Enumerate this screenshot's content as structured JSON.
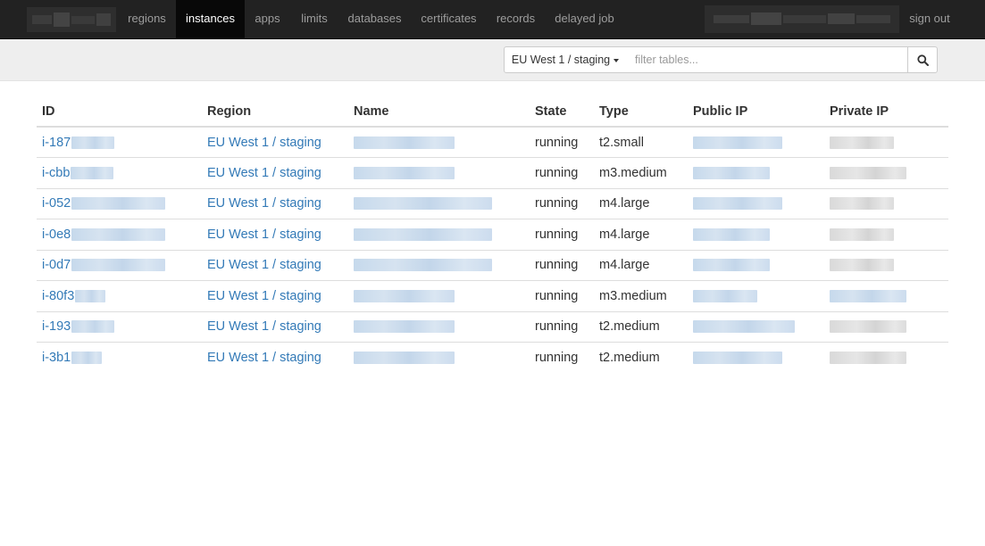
{
  "nav": {
    "items": [
      {
        "label": "regions",
        "active": false
      },
      {
        "label": "instances",
        "active": true
      },
      {
        "label": "apps",
        "active": false
      },
      {
        "label": "limits",
        "active": false
      },
      {
        "label": "databases",
        "active": false
      },
      {
        "label": "certificates",
        "active": false
      },
      {
        "label": "records",
        "active": false
      },
      {
        "label": "delayed job",
        "active": false
      }
    ],
    "sign_out": "sign out"
  },
  "toolbar": {
    "region_selected": "EU West 1 / staging",
    "filter_placeholder": "filter tables...",
    "filter_value": "",
    "search_icon": "search-icon"
  },
  "table": {
    "columns": [
      "ID",
      "Region",
      "Name",
      "State",
      "Type",
      "Public IP",
      "Private IP"
    ],
    "rows": [
      {
        "id_prefix": "i-187",
        "region": "EU West 1 / staging",
        "state": "running",
        "type": "t2.small"
      },
      {
        "id_prefix": "i-cbb",
        "region": "EU West 1 / staging",
        "state": "running",
        "type": "m3.medium"
      },
      {
        "id_prefix": "i-052",
        "region": "EU West 1 / staging",
        "state": "running",
        "type": "m4.large"
      },
      {
        "id_prefix": "i-0e8",
        "region": "EU West 1 / staging",
        "state": "running",
        "type": "m4.large"
      },
      {
        "id_prefix": "i-0d7",
        "region": "EU West 1 / staging",
        "state": "running",
        "type": "m4.large"
      },
      {
        "id_prefix": "i-80f3",
        "region": "EU West 1 / staging",
        "state": "running",
        "type": "m3.medium"
      },
      {
        "id_prefix": "i-193",
        "region": "EU West 1 / staging",
        "state": "running",
        "type": "t2.medium"
      },
      {
        "id_prefix": "i-3b1",
        "region": "EU West 1 / staging",
        "state": "running",
        "type": "t2.medium"
      }
    ]
  },
  "colors": {
    "navbar_bg": "#222222",
    "navbar_active_bg": "#080808",
    "link": "#337ab7",
    "toolbar_bg": "#eeeeee"
  }
}
